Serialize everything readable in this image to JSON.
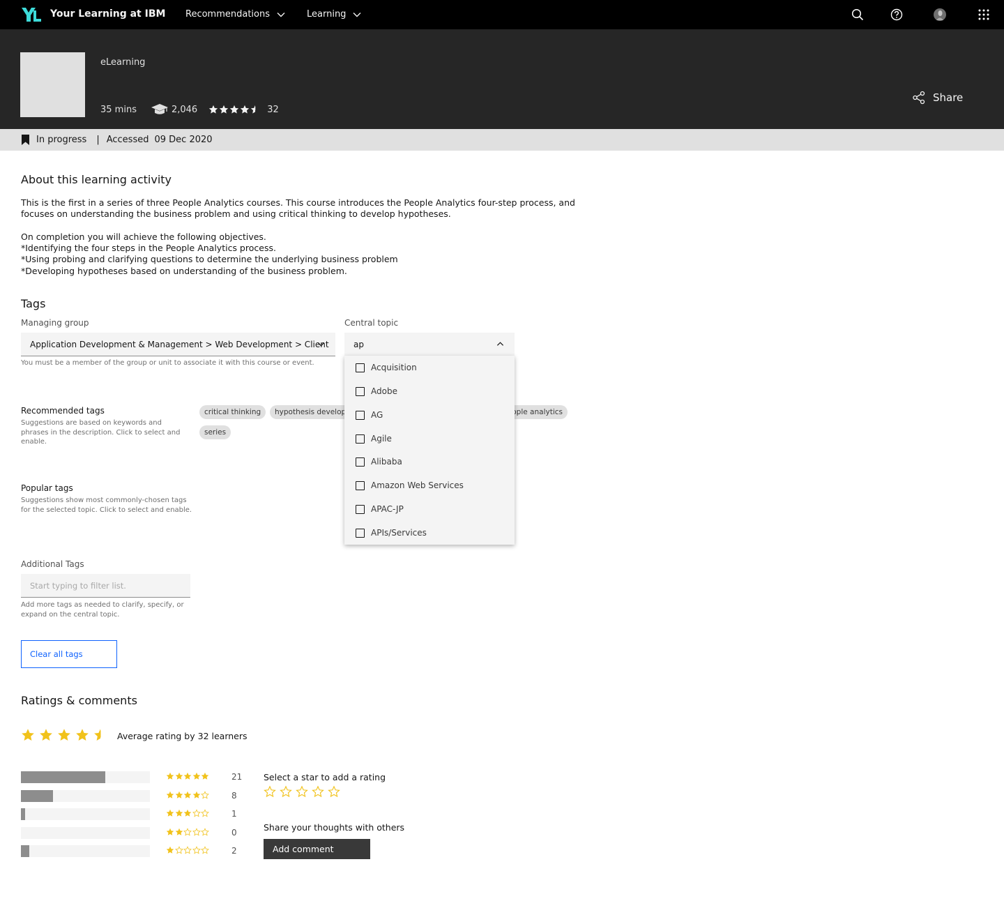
{
  "nav": {
    "brand": "Your Learning at IBM",
    "menus": [
      {
        "label": "Recommendations"
      },
      {
        "label": "Learning"
      }
    ],
    "icons": [
      "search-icon",
      "help-icon",
      "avatar",
      "app-switcher-icon"
    ]
  },
  "hero": {
    "type": "eLearning",
    "duration": "35 mins",
    "learners": "2,046",
    "rating_count": "32",
    "rating_value": 4.5,
    "share_label": "Share"
  },
  "status": {
    "state": "In progress",
    "separator": "|",
    "accessed_label": "Accessed",
    "accessed_date": "09 Dec 2020"
  },
  "about": {
    "heading": "About this learning activity",
    "description": "This is the first in a series of three People Analytics courses.  This course introduces the People Analytics four-step process, and focuses on understanding the business problem and using critical thinking to develop hypotheses.\n\nOn completion you will achieve the following objectives.\n*Identifying the four steps in the People Analytics process.\n*Using probing and clarifying questions to determine the underlying business problem\n*Developing hypotheses based on understanding of the business problem."
  },
  "tags": {
    "heading": "Tags",
    "managing_group": {
      "label": "Managing group",
      "value": "Application Development & Management > Web Development > Client",
      "help": "You must be a member of the group or unit to associate it with this course or event."
    },
    "central_topic": {
      "label": "Central topic",
      "value": "ap",
      "options": [
        "Acquisition",
        "Adobe",
        "AG",
        "Agile",
        "Alibaba",
        "Amazon Web Services",
        "APAC-JP",
        "APIs/Services"
      ]
    },
    "recommended": {
      "label": "Recommended tags",
      "help": "Suggestions are based on keywords and phrases in the description. Click to select and enable.",
      "chips": [
        "critical thinking",
        "hypothesis development",
        "people analytics",
        "series"
      ]
    },
    "popular": {
      "label": "Popular tags",
      "help": "Suggestions show most commonly-chosen tags for the selected topic. Click to select and enable."
    },
    "additional": {
      "label": "Additional Tags",
      "placeholder": "Start typing to filter list.",
      "help": "Add more tags as needed to clarify, specify, or expand on the central topic."
    },
    "clear_label": "Clear all tags"
  },
  "ratings": {
    "heading": "Ratings & comments",
    "average_value": 4.5,
    "average_text": "Average rating by 32 learners",
    "breakdown": [
      {
        "stars": 5,
        "count": "21",
        "fraction": 0.656
      },
      {
        "stars": 4,
        "count": "8",
        "fraction": 0.25
      },
      {
        "stars": 3,
        "count": "1",
        "fraction": 0.031
      },
      {
        "stars": 2,
        "count": "0",
        "fraction": 0
      },
      {
        "stars": 1,
        "count": "2",
        "fraction": 0.0625
      }
    ],
    "select_star_label": "Select a star to add a rating",
    "share_thoughts_label": "Share your thoughts with others",
    "add_comment_label": "Add comment"
  },
  "colors": {
    "nav_bg": "#000000",
    "hero_bg": "#262626",
    "strip_bg": "#e0e0e0",
    "star_gold": "#f1c21b",
    "bar_fill": "#8d8d8d",
    "link_blue": "#0f62fe",
    "logo_teal": "#3ddbd9"
  }
}
